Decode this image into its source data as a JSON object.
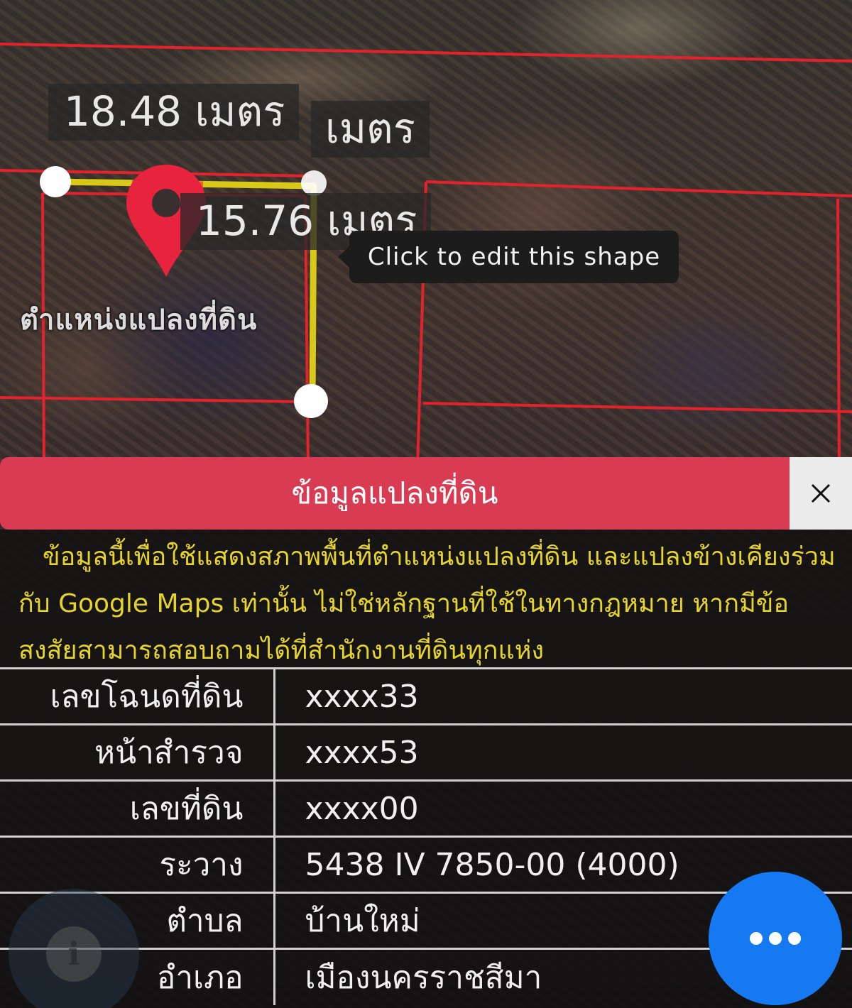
{
  "map": {
    "measurement_labels": [
      "18.48 เมตร",
      "เมตร",
      "15.76 เมตร"
    ],
    "tooltip": "Click to edit this shape",
    "pin_label": "ตำแหน่งแปลงที่ดิน",
    "colors": {
      "parcel_border": "#e3222c",
      "measure_line": "#d8c818",
      "pin": "#e8233d"
    }
  },
  "panel": {
    "title": "ข้อมูลแปลงที่ดิน",
    "close_icon": "close-icon",
    "disclaimer": "ข้อมูลนี้เพื่อใช้แสดงสภาพพื้นที่ตำแหน่งแปลงที่ดิน และแปลงข้างเคียงร่วมกับ Google Maps เท่านั้น ไม่ใช่หลักฐานที่ใช้ในทางกฎหมาย หากมีข้อสงสัยสามารถสอบถามได้ที่สำนักงานที่ดินทุกแห่ง",
    "rows": [
      {
        "label": "เลขโฉนดที่ดิน",
        "value": "xxxx33"
      },
      {
        "label": "หน้าสำรวจ",
        "value": "xxxx53"
      },
      {
        "label": "เลขที่ดิน",
        "value": "xxxx00"
      },
      {
        "label": "ระวาง",
        "value": "5438 IV 7850-00 (4000)"
      },
      {
        "label": "ตำบล",
        "value": "บ้านใหม่"
      },
      {
        "label": "อำเภอ",
        "value": "เมืองนครราชสีมา"
      }
    ],
    "colors": {
      "header": "#d93b52",
      "disclaimer_text": "#e6d42a"
    }
  },
  "fabs": {
    "info_icon": "info-icon",
    "more_icon": "more-dots-icon",
    "more_color": "#1579f2"
  }
}
